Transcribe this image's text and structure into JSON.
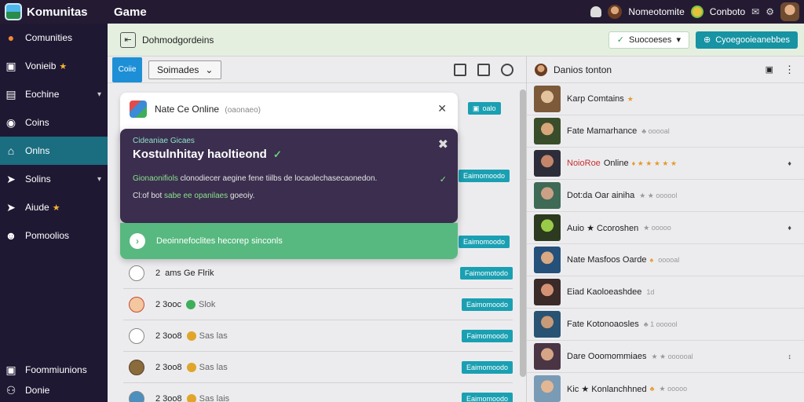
{
  "topbar": {
    "brand": "Komunitas",
    "section": "Game",
    "user_label": "Nomeotomite",
    "coins_label": "Conboto"
  },
  "sidebar": {
    "items": [
      {
        "label": "Comunities",
        "icon": "globe-icon",
        "chevron": false,
        "star": false
      },
      {
        "label": "Vonieib",
        "icon": "bookmark-icon",
        "chevron": false,
        "star": true
      },
      {
        "label": "Eochine",
        "icon": "calendar-icon",
        "chevron": true,
        "star": false
      },
      {
        "label": "Coins",
        "icon": "coin-icon",
        "chevron": false,
        "star": false
      },
      {
        "label": "Onlns",
        "icon": "home-icon",
        "chevron": false,
        "star": false,
        "active": true
      },
      {
        "label": "Solins",
        "icon": "send-icon",
        "chevron": true,
        "star": false
      },
      {
        "label": "Aiude",
        "icon": "send-icon",
        "chevron": false,
        "star": true
      },
      {
        "label": "Pomoolios",
        "icon": "user-icon",
        "chevron": false,
        "star": false
      }
    ],
    "bottom": [
      {
        "label": "Foommiunions",
        "icon": "lock-icon"
      },
      {
        "label": "Donie",
        "icon": "share-icon"
      }
    ]
  },
  "header": {
    "title": "Dohmodgordeins",
    "ghost_button": "Suocoeses",
    "primary_button": "Cyoegooieanebbes"
  },
  "toolbar": {
    "tab_label": "Coiie",
    "select_value": "Soimades"
  },
  "list": {
    "status_chip": "oalo",
    "rows": [
      {
        "num": "2",
        "label": "ams Ge Flrik",
        "tag": "",
        "coin_color": "",
        "button": "Faimomotodo",
        "icon_class": "ic1"
      },
      {
        "num": "2 3ooc",
        "label": "",
        "tag": "Slok",
        "coin_color": "#3fae5a",
        "button": "Eaimomoodo",
        "icon_class": "ic2"
      },
      {
        "num": "2 3oo8",
        "label": "",
        "tag": "Sas las",
        "coin_color": "#e0a52a",
        "button": "Faimomoodo",
        "icon_class": "ic3"
      },
      {
        "num": "2 3oo8",
        "label": "",
        "tag": "Sas las",
        "coin_color": "#e0a52a",
        "button": "Eaimomoodo",
        "icon_class": "ic4"
      },
      {
        "num": "2 3oo8",
        "label": "",
        "tag": "Sas lais",
        "coin_color": "#e0a52a",
        "button": "Eaimomoodo",
        "icon_class": "ic5"
      }
    ],
    "hidden_buttons": [
      "Eaimomoodo",
      "Eaimomoodo"
    ]
  },
  "modal": {
    "title": "Nate Ce Online",
    "subtitle": "(oaonaeo)",
    "kicker": "Cideaniae Gicaes",
    "headline": "Kostulnhitay haoltieond",
    "line1_highlight": "Gionaonifiols",
    "line1_rest": "clonodiecer aegine fene tiilbs de locaolechasecaonedon.",
    "line2_prefix": "Cl:of bot",
    "line2_highlight": "sabe ee opanilaes",
    "line2_suffix": "goeoiy.",
    "toast": "Deoinnefoclites hecorep sinconls"
  },
  "friends_panel": {
    "title": "Danios tonton",
    "friends": [
      {
        "name": "Karp Comtains",
        "extra": "★",
        "gray": "",
        "arrow": "",
        "red": false,
        "colors": [
          "#7d5a3a",
          "#e3c39d"
        ]
      },
      {
        "name": "Fate Mamarhance",
        "extra": "",
        "gray": "♣ ooooal",
        "arrow": "",
        "red": false,
        "colors": [
          "#3a4d2a",
          "#d7a77b"
        ]
      },
      {
        "name": "NoioRoe",
        "suffix": "Online",
        "extra": "♦ ★ ★ ★ ★ ★",
        "gray": "",
        "arrow": "♦",
        "red": true,
        "colors": [
          "#2d2d3a",
          "#c4856a"
        ]
      },
      {
        "name": "Dot:da Oar ainiha",
        "extra": "",
        "gray": "★ ★ oooool",
        "arrow": "",
        "red": false,
        "colors": [
          "#3f6a55",
          "#caa087"
        ]
      },
      {
        "name": "Auio ★ Ccoroshen",
        "extra": "",
        "gray": "★ ooooo",
        "arrow": "♦",
        "red": false,
        "colors": [
          "#2c3a1f",
          "#9acb48"
        ]
      },
      {
        "name": "Nate Masfoos Oarde",
        "extra": "♠",
        "gray": "ooooal",
        "arrow": "",
        "red": false,
        "colors": [
          "#24507a",
          "#d8a982"
        ]
      },
      {
        "name": "Eiad Kaoloeashdee",
        "extra": "",
        "gray": "1d",
        "arrow": "",
        "red": false,
        "colors": [
          "#3a2a28",
          "#d49275"
        ]
      },
      {
        "name": "Fate Kotonoaosles",
        "extra": "",
        "gray": "♣ 1 oooool",
        "arrow": "",
        "red": false,
        "colors": [
          "#2a5272",
          "#c89a77"
        ]
      },
      {
        "name": "Dare Ooomommiaes",
        "extra": "",
        "gray": "★ ★ oooooal",
        "arrow": "↕",
        "red": false,
        "colors": [
          "#4a3545",
          "#d5a585"
        ]
      },
      {
        "name": "Kic ★ Konlanchhned",
        "extra": "♣",
        "gray": "★ ooooo",
        "arrow": "",
        "red": false,
        "colors": [
          "#7a9bb5",
          "#e3b793"
        ]
      }
    ]
  }
}
